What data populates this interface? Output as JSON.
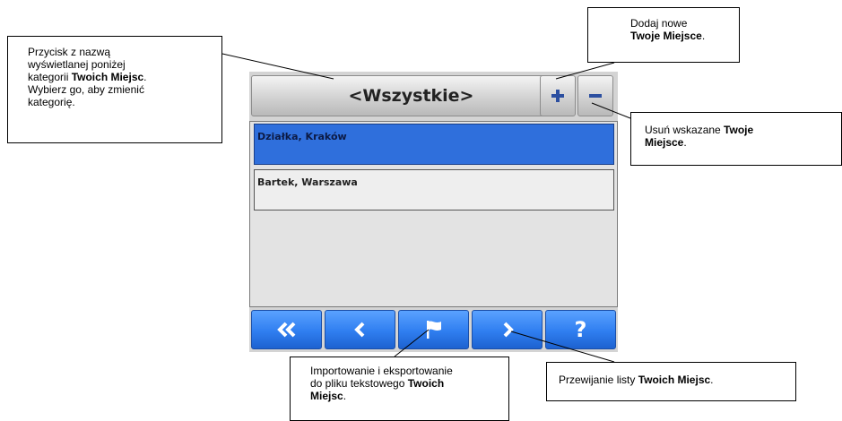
{
  "device": {
    "category_button": {
      "label": "<Wszystkie>"
    },
    "add_button": {
      "icon": "plus-icon"
    },
    "delete_button": {
      "icon": "minus-icon"
    },
    "list": {
      "items": [
        {
          "label": "Działka, Kraków",
          "selected": true
        },
        {
          "label": "Bartek, Warszawa",
          "selected": false
        }
      ]
    },
    "toolbar": {
      "buttons": [
        {
          "icon": "double-chevron-left-icon"
        },
        {
          "icon": "chevron-left-icon"
        },
        {
          "icon": "flag-icon"
        },
        {
          "icon": "chevron-right-icon"
        },
        {
          "icon": "question-icon",
          "text": "?"
        }
      ]
    }
  },
  "callouts": {
    "category": {
      "line1": "Przycisk z nazwą",
      "line2": "wyświetlanej poniżej",
      "line3_a": "kategorii ",
      "line3_b": "Twoich Miejsc",
      "line3_c": ".",
      "line4": "Wybierz go, aby zmienić",
      "line5": "kategorię."
    },
    "add": {
      "line1": "Dodaj nowe",
      "line2_b": "Twoje Miejsce",
      "line2_c": "."
    },
    "delete": {
      "line1_a": "Usuń wskazane ",
      "line1_b": "Twoje",
      "line2_b": "Miejsce",
      "line2_c": "."
    },
    "import": {
      "line1": "Importowanie i eksportowanie",
      "line2_a": "do pliku tekstowego ",
      "line2_b": "Twoich",
      "line3_b": "Miejsc",
      "line3_c": "."
    },
    "scroll": {
      "line1_a": "Przewijanie listy ",
      "line1_b": "Twoich Miejsc",
      "line1_c": "."
    }
  },
  "colors": {
    "selected_row": "#2f6fdc",
    "toolbar_button": "#2f7ef0"
  }
}
